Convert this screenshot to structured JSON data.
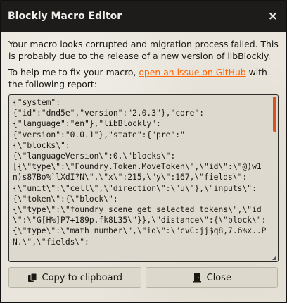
{
  "window": {
    "title": "Blockly Macro Editor",
    "close_glyph": "×"
  },
  "message": {
    "line1": "Your macro looks corrupted and migration process failed. This is probably due to the release of a new version of libBlockly.",
    "line2_prefix": "To help me to fix your macro, ",
    "link_text": "open an issue on GitHub",
    "line2_suffix": " with the following report:"
  },
  "report": {
    "text": "{\"system\":\n{\"id\":\"dnd5e\",\"version\":\"2.0.3\"},\"core\":\n{\"language\":\"en\"},\"libBlockly\":\n{\"version\":\"0.0.1\"},\"state\":{\"pre\":\"\n{\\\"blocks\\\":\n{\\\"languageVersion\\\":0,\\\"blocks\\\":\n[{\\\"type\\\":\\\"Foundry.Token.MoveToken\\\",\\\"id\\\":\\\"@)w1n)s87Bo%`lXdI?N\\\",\\\"x\\\":215,\\\"y\\\":167,\\\"fields\\\":\n{\\\"unit\\\":\\\"cell\\\",\\\"direction\\\":\\\"u\\\"},\\\"inputs\\\":{\\\"token\\\":{\\\"block\\\":\n{\\\"type\\\":\\\"foundry_scene_get_selected_tokens\\\",\\\"id\\\":\\\"G[H%]P7+189p.fk8L35\\\"}},\\\"distance\\\":{\\\"block\\\":\n{\\\"type\\\":\\\"math_number\\\",\\\"id\\\":\\\"cvC:jj$q8,7.6%x..PN.\\\",\\\"fields\\\":"
  },
  "buttons": {
    "copy_label": "Copy to clipboard",
    "copy_icon": "copy-icon",
    "close_label": "Close",
    "close_icon": "door-icon"
  },
  "colors": {
    "titlebar": "#1e1c1a",
    "link": "#ff6400",
    "scrollbar": "#d9531f",
    "panel": "#e9e5dc"
  }
}
